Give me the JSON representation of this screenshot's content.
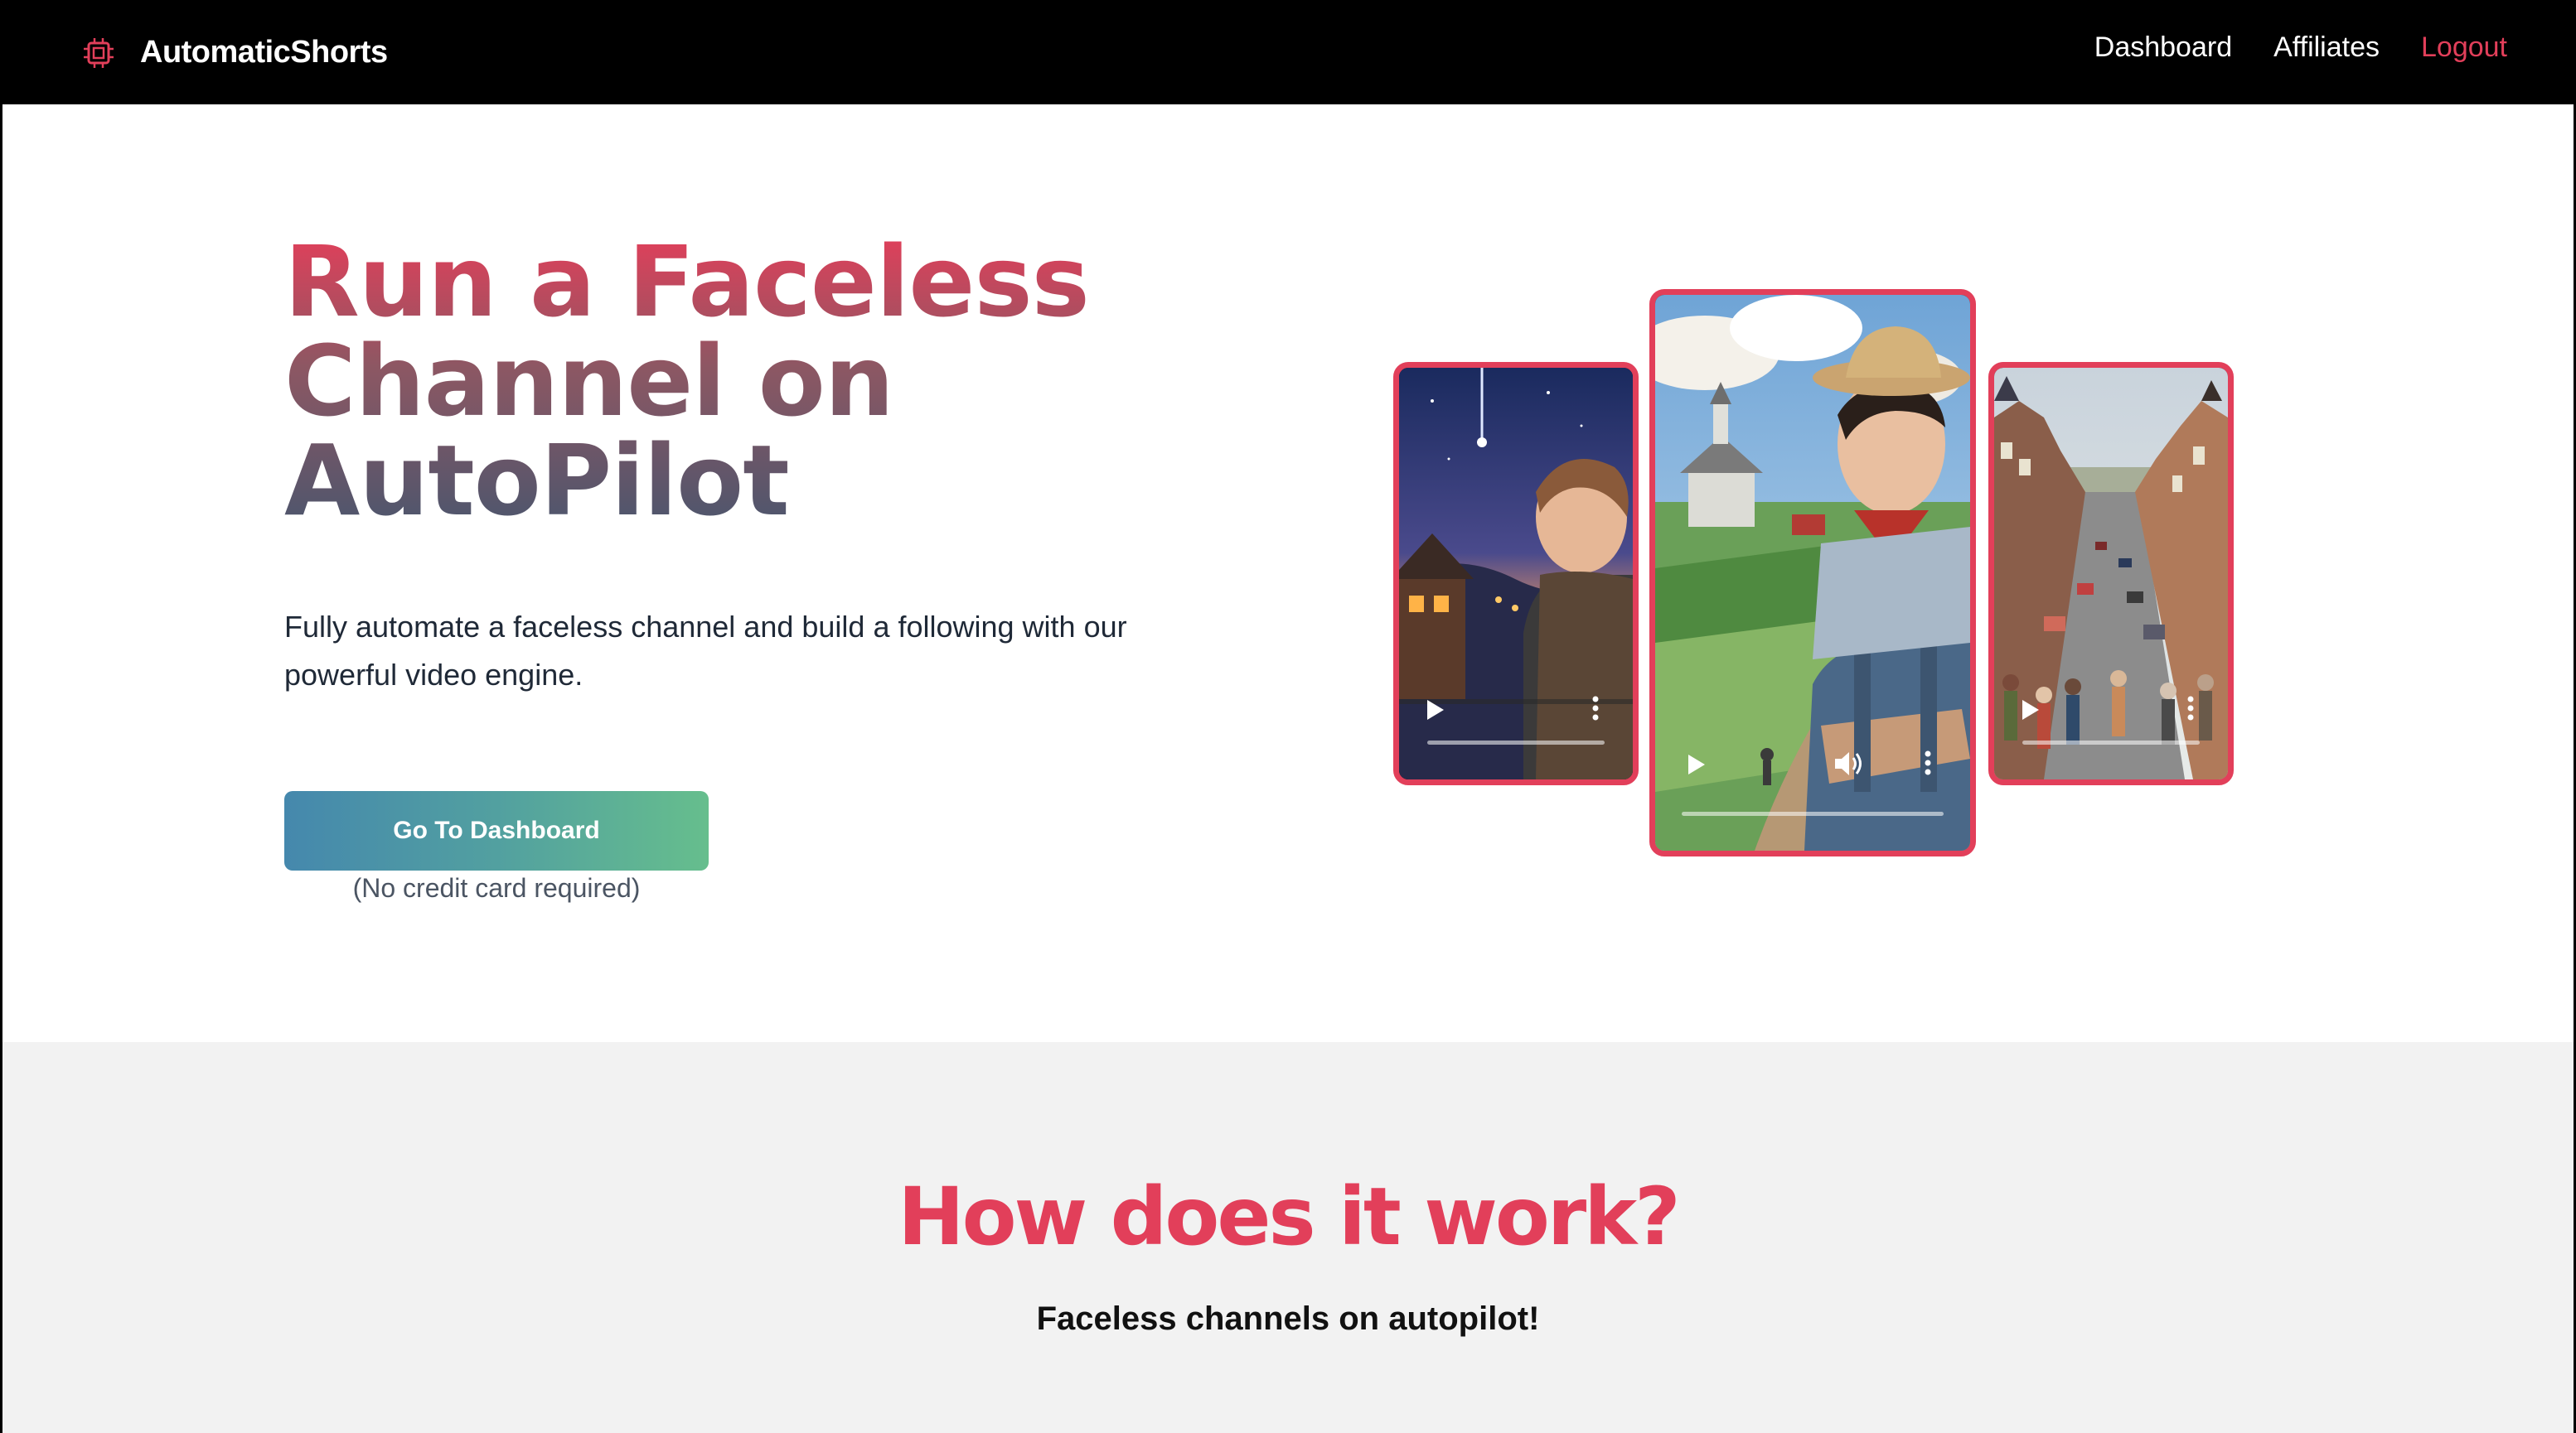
{
  "nav": {
    "brand": "AutomaticShorts",
    "brand_icon": "chip-icon",
    "links": [
      "Dashboard",
      "Affiliates",
      "Logout"
    ]
  },
  "hero": {
    "title_lines": [
      "Run a Faceless",
      "Channel on",
      "AutoPilot"
    ],
    "subtitle": "Fully automate a faceless channel and build a following with our powerful video engine.",
    "cta_label": "Go To Dashboard",
    "cta_note": "(No credit card required)"
  },
  "videos": [
    {
      "scene": "boy-night-village",
      "icons": [
        "play-icon",
        "more-icon"
      ]
    },
    {
      "scene": "farmer-countryside",
      "icons": [
        "play-icon",
        "volume-icon",
        "more-icon"
      ]
    },
    {
      "scene": "town-street",
      "icons": [
        "play-icon",
        "more-icon"
      ]
    }
  ],
  "how": {
    "title": "How does it work?",
    "subtitle": "Faceless channels on autopilot!"
  },
  "colors": {
    "accent": "#e23f5a",
    "nav_bg": "#000000",
    "section_bg": "#f2f2f2",
    "cta_gradient_start": "#4588ad",
    "cta_gradient_end": "#66be8d"
  }
}
